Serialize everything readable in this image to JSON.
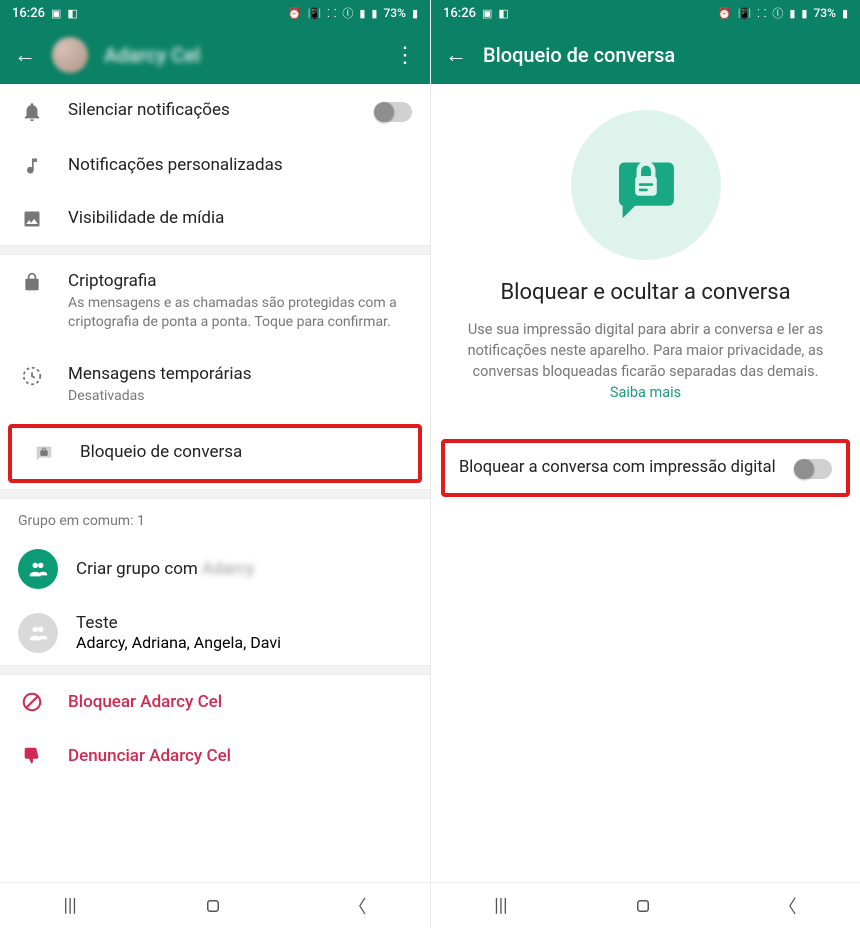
{
  "statusbar": {
    "time": "16:26",
    "battery": "73%"
  },
  "left": {
    "header": {
      "contact_name": "Adarcy Cel"
    },
    "items": {
      "mute": {
        "label": "Silenciar notificações"
      },
      "custom_notif": {
        "label": "Notificações personalizadas"
      },
      "media_vis": {
        "label": "Visibilidade de mídia"
      },
      "crypto": {
        "label": "Criptografia",
        "sub": "As mensagens e as chamadas são protegidas com a criptografia de ponta a ponta. Toque para confirmar."
      },
      "temp_msgs": {
        "label": "Mensagens temporárias",
        "sub": "Desativadas"
      },
      "chat_lock": {
        "label": "Bloqueio de conversa"
      }
    },
    "groups": {
      "header": "Grupo em comum: 1",
      "create_prefix": "Criar grupo com ",
      "create_name_blur": "Adarcy",
      "teste": {
        "label": "Teste",
        "sub_blur": "Adarcy, Adriana, Angela, Davi"
      }
    },
    "danger": {
      "block": "Bloquear Adarcy Cel",
      "report": "Denunciar Adarcy Cel"
    }
  },
  "right": {
    "header": {
      "title": "Bloqueio de conversa"
    },
    "hero": {
      "title": "Bloquear e ocultar a conversa",
      "desc": "Use sua impressão digital para abrir a conversa e ler as notificações neste aparelho. Para maior privacidade, as conversas bloqueadas ficarão separadas das demais. ",
      "learn_more": "Saiba mais"
    },
    "toggle": {
      "label": "Bloquear a conversa com impressão digital"
    }
  }
}
